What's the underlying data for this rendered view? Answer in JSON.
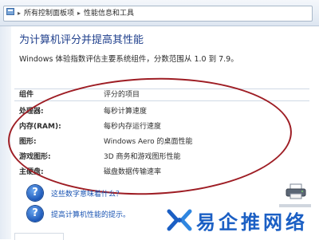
{
  "address_bar": {
    "segments": [
      "所有控制面板项",
      "性能信息和工具"
    ]
  },
  "page": {
    "title": "为计算机评分并提高其性能",
    "description": "Windows 体验指数评估主要系统组件，分数范围从 1.0 到 7.9。"
  },
  "table": {
    "headers": [
      "组件",
      "评分的项目"
    ],
    "rows": [
      {
        "component": "处理器:",
        "item": "每秒计算速度"
      },
      {
        "component": "内存(RAM):",
        "item": "每秒内存运行速度"
      },
      {
        "component": "图形:",
        "item": "Windows Aero 的桌面性能"
      },
      {
        "component": "游戏图形:",
        "item": "3D 商务和游戏图形性能"
      },
      {
        "component": "主硬盘:",
        "item": "磁盘数据传输速率"
      }
    ]
  },
  "help_links": [
    {
      "label": "这些数字意味着什么？",
      "icon": "help-question-icon"
    },
    {
      "label": "提高计算机性能的提示。",
      "icon": "help-question-icon"
    }
  ],
  "watermark": {
    "text": "易企推网络"
  },
  "colors": {
    "title": "#1f3f8c",
    "link": "#1a54b3",
    "annotation": "#9e1d24",
    "watermark": "#1b5fc4"
  }
}
